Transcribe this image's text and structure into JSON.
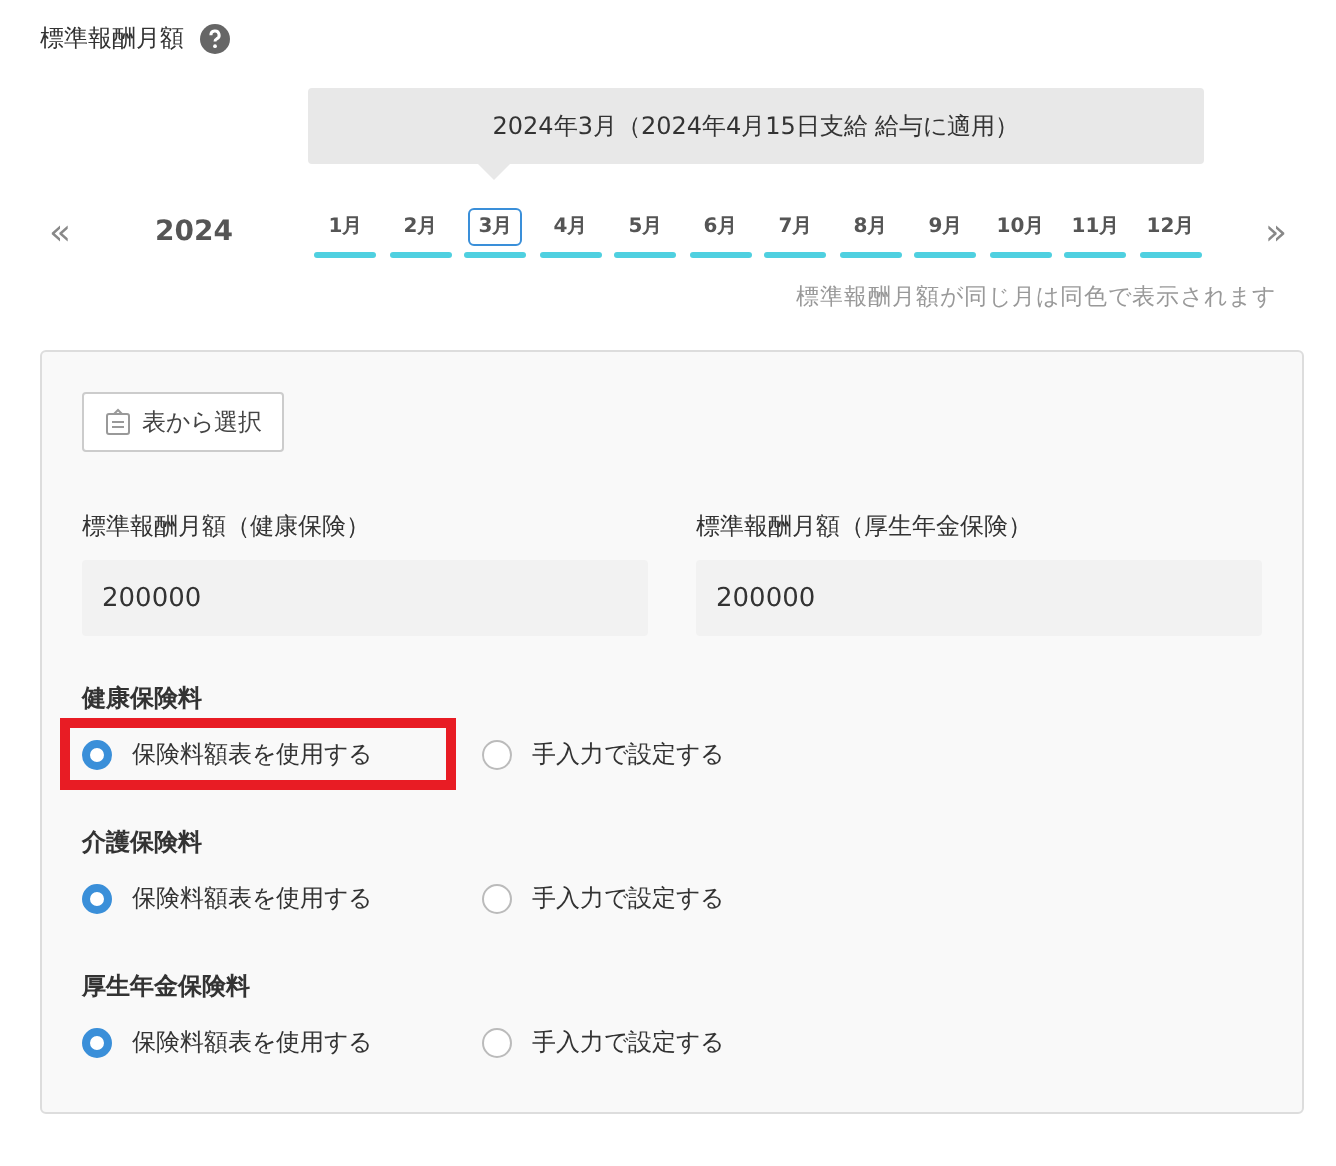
{
  "title": "標準報酬月額",
  "tooltip": "2024年3月（2024年4月15日支給 給与に適用）",
  "year": "2024",
  "prev": "«",
  "next": "»",
  "months": [
    {
      "label": "1月",
      "selected": false,
      "color": "#4fd0e0"
    },
    {
      "label": "2月",
      "selected": false,
      "color": "#4fd0e0"
    },
    {
      "label": "3月",
      "selected": true,
      "color": "#4fd0e0"
    },
    {
      "label": "4月",
      "selected": false,
      "color": "#4fd0e0"
    },
    {
      "label": "5月",
      "selected": false,
      "color": "#4fd0e0"
    },
    {
      "label": "6月",
      "selected": false,
      "color": "#4fd0e0"
    },
    {
      "label": "7月",
      "selected": false,
      "color": "#4fd0e0"
    },
    {
      "label": "8月",
      "selected": false,
      "color": "#4fd0e0"
    },
    {
      "label": "9月",
      "selected": false,
      "color": "#4fd0e0"
    },
    {
      "label": "10月",
      "selected": false,
      "color": "#4fd0e0"
    },
    {
      "label": "11月",
      "selected": false,
      "color": "#4fd0e0"
    },
    {
      "label": "12月",
      "selected": false,
      "color": "#4fd0e0"
    }
  ],
  "note": "標準報酬月額が同じ月は同色で表示されます",
  "select_button": "表から選択",
  "fields": [
    {
      "label": "標準報酬月額（健康保険）",
      "value": "200000"
    },
    {
      "label": "標準報酬月額（厚生年金保険）",
      "value": "200000"
    }
  ],
  "groups": [
    {
      "label": "健康保険料",
      "options": [
        {
          "label": "保険料額表を使用する",
          "selected": true,
          "highlighted": true
        },
        {
          "label": "手入力で設定する",
          "selected": false,
          "highlighted": false
        }
      ]
    },
    {
      "label": "介護保険料",
      "options": [
        {
          "label": "保険料額表を使用する",
          "selected": true,
          "highlighted": false
        },
        {
          "label": "手入力で設定する",
          "selected": false,
          "highlighted": false
        }
      ]
    },
    {
      "label": "厚生年金保険料",
      "options": [
        {
          "label": "保険料額表を使用する",
          "selected": true,
          "highlighted": false
        },
        {
          "label": "手入力で設定する",
          "selected": false,
          "highlighted": false
        }
      ]
    }
  ]
}
